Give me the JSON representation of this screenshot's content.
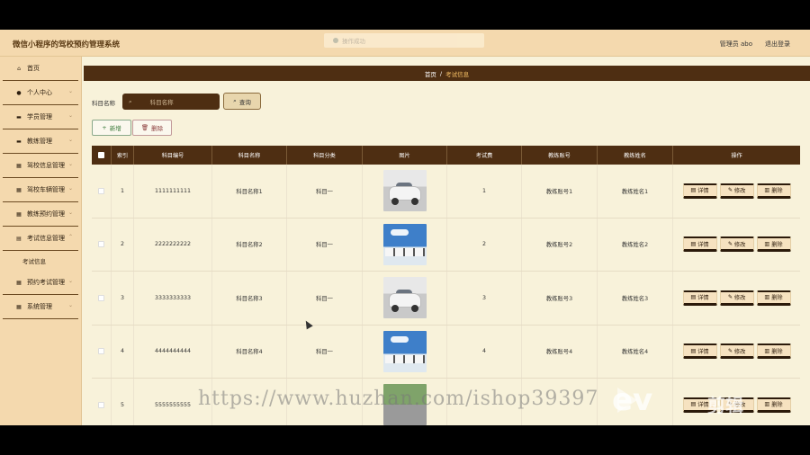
{
  "header": {
    "app_title": "微信小程序的驾校预约管理系统",
    "toast_text": "操作成功",
    "user_label": "管理员 abo",
    "logout_label": "退出登录"
  },
  "sidebar": {
    "items": [
      {
        "label": "首页",
        "icon": "home-icon"
      },
      {
        "label": "个人中心",
        "icon": "user-icon"
      },
      {
        "label": "学员管理",
        "icon": "briefcase-icon"
      },
      {
        "label": "教练管理",
        "icon": "briefcase-icon"
      },
      {
        "label": "驾校信息管理",
        "icon": "grid-icon"
      },
      {
        "label": "驾校车辆管理",
        "icon": "grid-icon"
      },
      {
        "label": "教练预约管理",
        "icon": "grid-icon"
      },
      {
        "label": "考试信息管理",
        "icon": "doc-icon"
      },
      {
        "label": "预约考试管理",
        "icon": "grid-icon"
      },
      {
        "label": "系统管理",
        "icon": "grid-icon"
      }
    ],
    "sub_item": "考试信息"
  },
  "breadcrumb": {
    "home": "首页",
    "sep": "/",
    "current": "考试信息"
  },
  "search": {
    "label": "科目名称",
    "placeholder": "科目名称",
    "query_label": "查询"
  },
  "actions": {
    "add_label": "新增",
    "delete_label": "删除"
  },
  "table": {
    "headers": [
      "索引",
      "科目编号",
      "科目名称",
      "科目分类",
      "图片",
      "考试费",
      "教练账号",
      "教练姓名",
      "操作"
    ],
    "rows": [
      {
        "idx": "1",
        "code": "1111111111",
        "name": "科目名称1",
        "cat": "科目一",
        "image": "car",
        "fee": "1",
        "acct": "教练账号1",
        "coach": "教练姓名1"
      },
      {
        "idx": "2",
        "code": "2222222222",
        "name": "科目名称2",
        "cat": "科目一",
        "image": "fleet",
        "fee": "2",
        "acct": "教练账号2",
        "coach": "教练姓名2"
      },
      {
        "idx": "3",
        "code": "3333333333",
        "name": "科目名称3",
        "cat": "科目一",
        "image": "car",
        "fee": "3",
        "acct": "教练账号3",
        "coach": "教练姓名3"
      },
      {
        "idx": "4",
        "code": "4444444444",
        "name": "科目名称4",
        "cat": "科目一",
        "image": "fleet",
        "fee": "4",
        "acct": "教练账号4",
        "coach": "教练姓名4"
      },
      {
        "idx": "5",
        "code": "5555555555",
        "name": "",
        "cat": "",
        "image": "park",
        "fee": "",
        "acct": "",
        "coach": ""
      }
    ],
    "op_labels": {
      "detail": "详情",
      "edit": "修改",
      "delete": "删除"
    }
  },
  "watermark": {
    "text": "https://www.huzhan.com/ishop39397",
    "brand": "ev",
    "brand_cn": "剪辑"
  }
}
